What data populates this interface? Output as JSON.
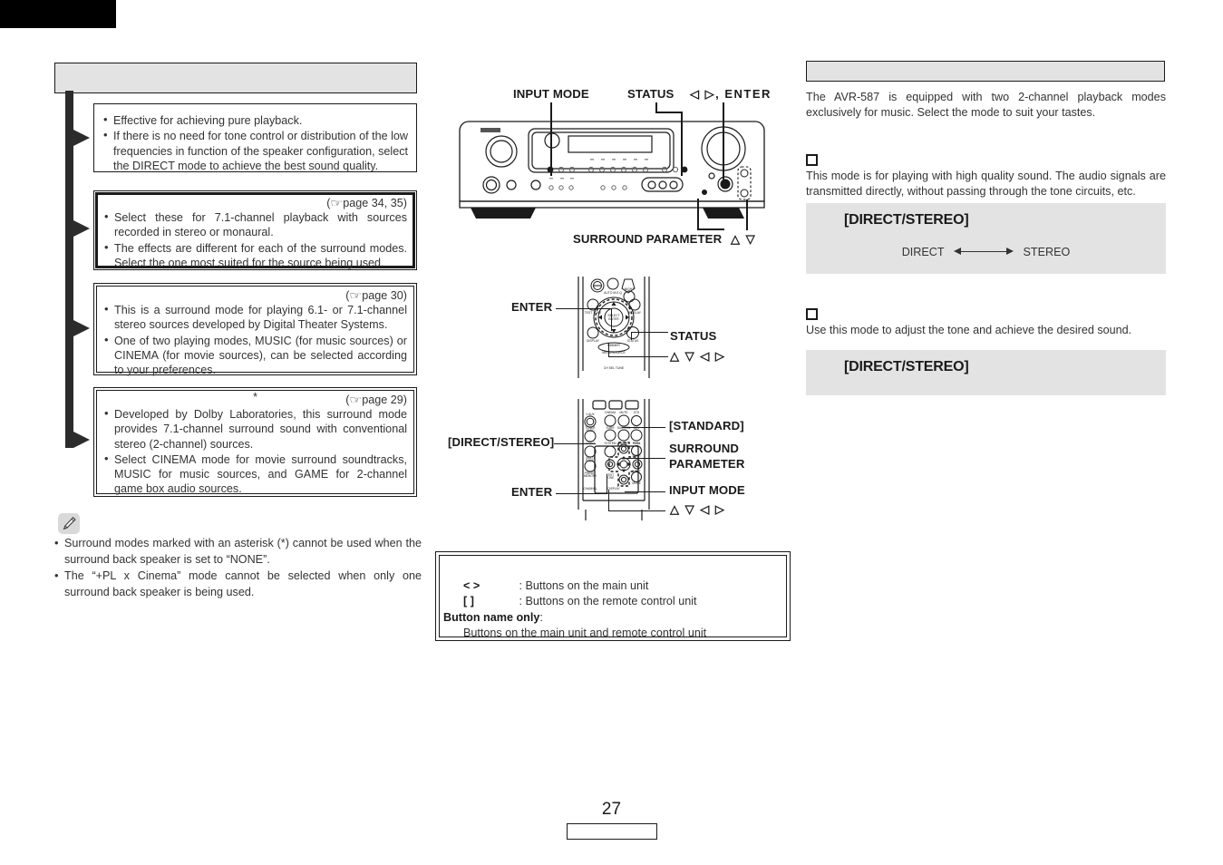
{
  "page": {
    "number": "27"
  },
  "left_column": {
    "header_label": "",
    "boxes": [
      {
        "page_ref": "",
        "asterisk": "",
        "bullets": [
          "Effective for achieving pure playback.",
          "If there is no need for tone control or distribution of the low frequencies in function of the speaker configuration, select the DIRECT mode to achieve the best sound quality."
        ]
      },
      {
        "page_ref": "page 34, 35",
        "asterisk": "",
        "bullets": [
          "Select these for 7.1-channel playback with sources recorded in stereo or monaural.",
          "The effects are different for each of the surround modes. Select the one most suited for the source being used."
        ]
      },
      {
        "page_ref": "page 30",
        "asterisk": "",
        "bullets": [
          "This is a surround mode for playing 6.1- or 7.1-channel stereo sources developed by Digital Theater Systems.",
          "One of two playing modes, MUSIC (for music sources) or CINEMA (for movie sources), can be selected according to your preferences."
        ]
      },
      {
        "page_ref": "page 29",
        "asterisk": "*",
        "bullets": [
          "Developed by Dolby Laboratories, this surround mode provides 7.1-channel surround sound with conventional stereo (2-channel) sources.",
          "Select CINEMA mode for movie surround soundtracks, MUSIC for music sources, and GAME for 2-channel game box audio sources."
        ]
      }
    ],
    "note": {
      "icon": "pencil-icon",
      "bullets": [
        "Surround modes marked with an asterisk (*) cannot be used when the surround back speaker is set to “NONE”.",
        "The “+PL x Cinema” mode cannot be selected when only one surround back speaker is being used."
      ]
    }
  },
  "middle_column": {
    "main_unit_labels": {
      "input_mode": "INPUT MODE",
      "status": "STATUS",
      "left_right_enter": "◁ ▷, ENTER",
      "surround_parameter": "SURROUND PARAMETER",
      "up_down": "△ ▽"
    },
    "remote_top_labels": {
      "enter": "ENTER",
      "status": "STATUS",
      "directions": "△ ▽ ◁ ▷"
    },
    "remote_bottom_labels": {
      "standard": "[STANDARD]",
      "direct_stereo": "[DIRECT/STEREO]",
      "surround_parameter_line1": "SURROUND",
      "surround_parameter_line2": "PARAMETER",
      "enter": "ENTER",
      "input_mode": "INPUT MODE",
      "directions": "△ ▽ ◁ ▷"
    },
    "legend": {
      "row1_symbol": "<    >",
      "row1_text": ": Buttons on the main unit",
      "row2_symbol": "[    ]",
      "row2_text": ": Buttons on the remote control unit",
      "row3_symbol": "Button name only",
      "row3_colon": ":",
      "row3_text": "Buttons on the main unit and remote control unit"
    }
  },
  "right_column": {
    "header_label": "",
    "intro": "The AVR-587 is equipped with two 2-channel playback modes exclusively for music. Select the mode to suit your tastes.",
    "sections": [
      {
        "marker": "square-marker",
        "description": "This mode is for playing with high quality sound. The audio signals are transmitted directly, without passing through the tone circuits, etc.",
        "panel_title": "[DIRECT/STEREO]",
        "flow": {
          "from": "DIRECT",
          "to": "STEREO"
        }
      },
      {
        "marker": "square-marker",
        "description": "Use this mode to adjust the tone and achieve the desired sound.",
        "panel_title": "[DIRECT/STEREO]",
        "flow": null
      }
    ]
  },
  "colors": {
    "header_gray": "#e3e3e3",
    "panel_gray": "#e3e3e3",
    "ink": "#231f20",
    "spine": "#2c2c2c"
  }
}
